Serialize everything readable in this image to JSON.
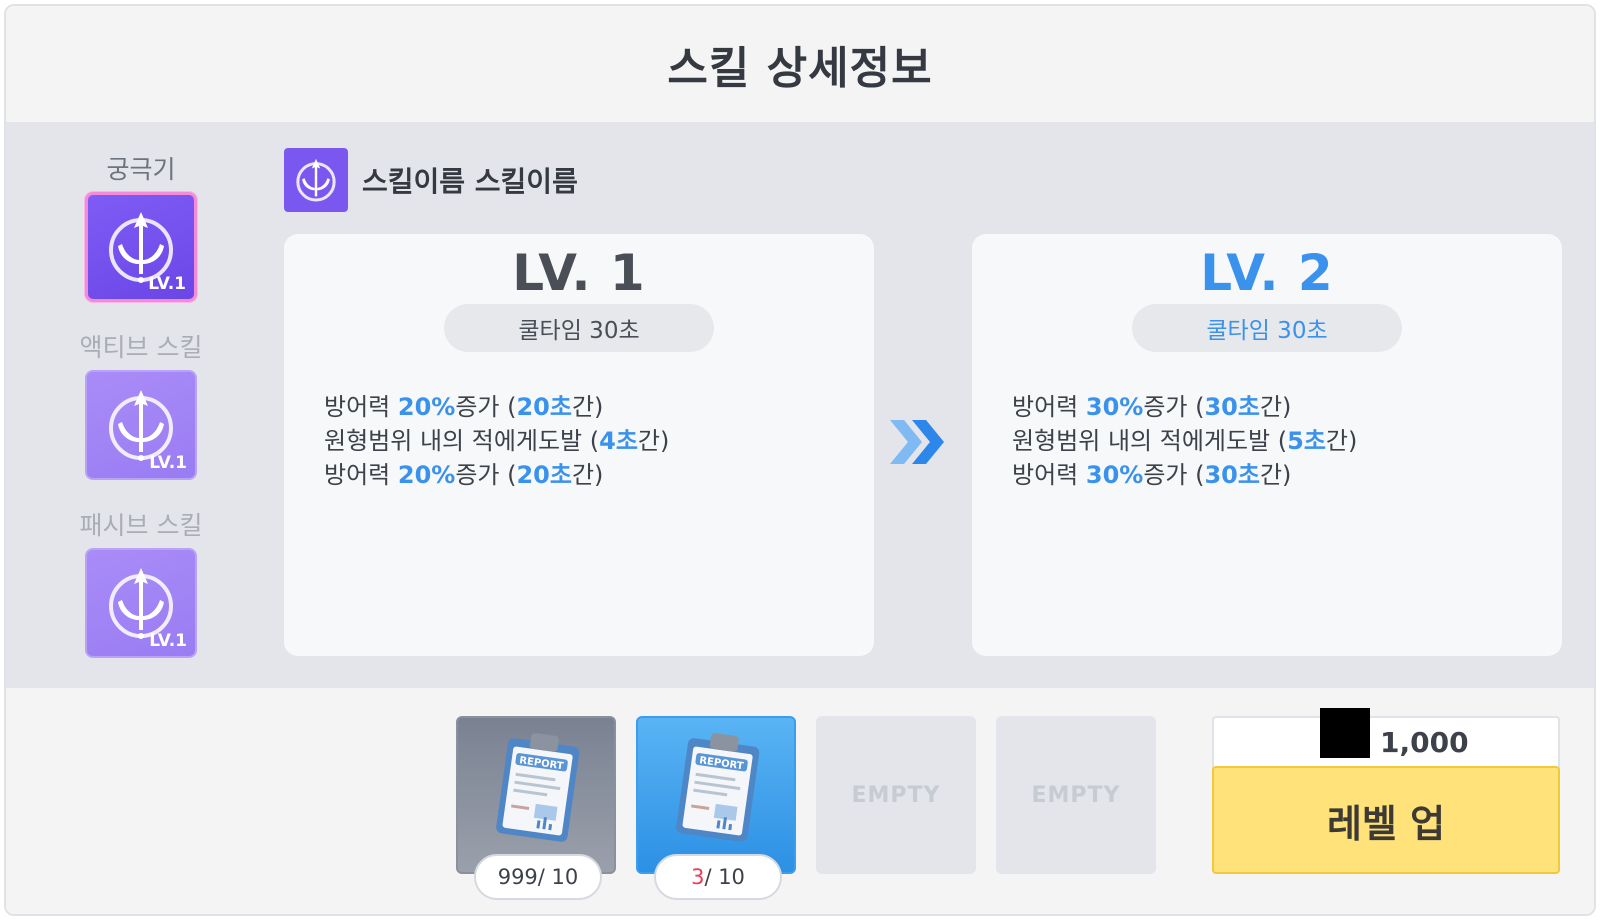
{
  "title": "스킬 상세정보",
  "tabs": [
    {
      "label": "궁극기",
      "level": "LV.1",
      "state": "active"
    },
    {
      "label": "액티브 스킬",
      "level": "LV.1",
      "state": "inactive"
    },
    {
      "label": "패시브 스킬",
      "level": "LV.1",
      "state": "inactive"
    }
  ],
  "skill": {
    "name": "스킬이름 스킬이름",
    "icon": "trident-emblem-icon"
  },
  "current": {
    "level": "LV. 1",
    "cooldown": "쿨타임 30초",
    "effects": [
      {
        "pre": "방어력 ",
        "hl1": "20%",
        "mid": "증가 (",
        "hl2": "20초",
        "post": "간)"
      },
      {
        "pre": "원형범위 내의 적에게도발 (",
        "hl1": "4초",
        "mid": "",
        "hl2": "",
        "post": "간)"
      },
      {
        "pre": "방어력 ",
        "hl1": "20%",
        "mid": "증가 (",
        "hl2": "20초",
        "post": "간)"
      }
    ]
  },
  "next": {
    "level": "LV. 2",
    "cooldown": "쿨타임 30초",
    "effects": [
      {
        "pre": "방어력 ",
        "hl1": "30%",
        "mid": "증가 (",
        "hl2": "30초",
        "post": "간)"
      },
      {
        "pre": "원형범위 내의 적에게도발 (",
        "hl1": "5초",
        "mid": "",
        "hl2": "",
        "post": "간)"
      },
      {
        "pre": "방어력 ",
        "hl1": "30%",
        "mid": "증가 (",
        "hl2": "30초",
        "post": "간)"
      }
    ]
  },
  "materials": [
    {
      "icon": "report-clipboard-icon",
      "current": "999",
      "required": " / 10",
      "bg": "grey"
    },
    {
      "icon": "report-clipboard-icon",
      "current": "3",
      "required": " / 10",
      "bg": "blue"
    },
    {
      "label": "EMPTY"
    },
    {
      "label": "EMPTY"
    }
  ],
  "cost": {
    "value": "1,000"
  },
  "levelup_label": "레벨 업",
  "colors": {
    "accent": "#3a92ec",
    "levelup": "#ffe27a",
    "skill_purple": "#7a58ef",
    "shortage": "#ee3b57"
  }
}
